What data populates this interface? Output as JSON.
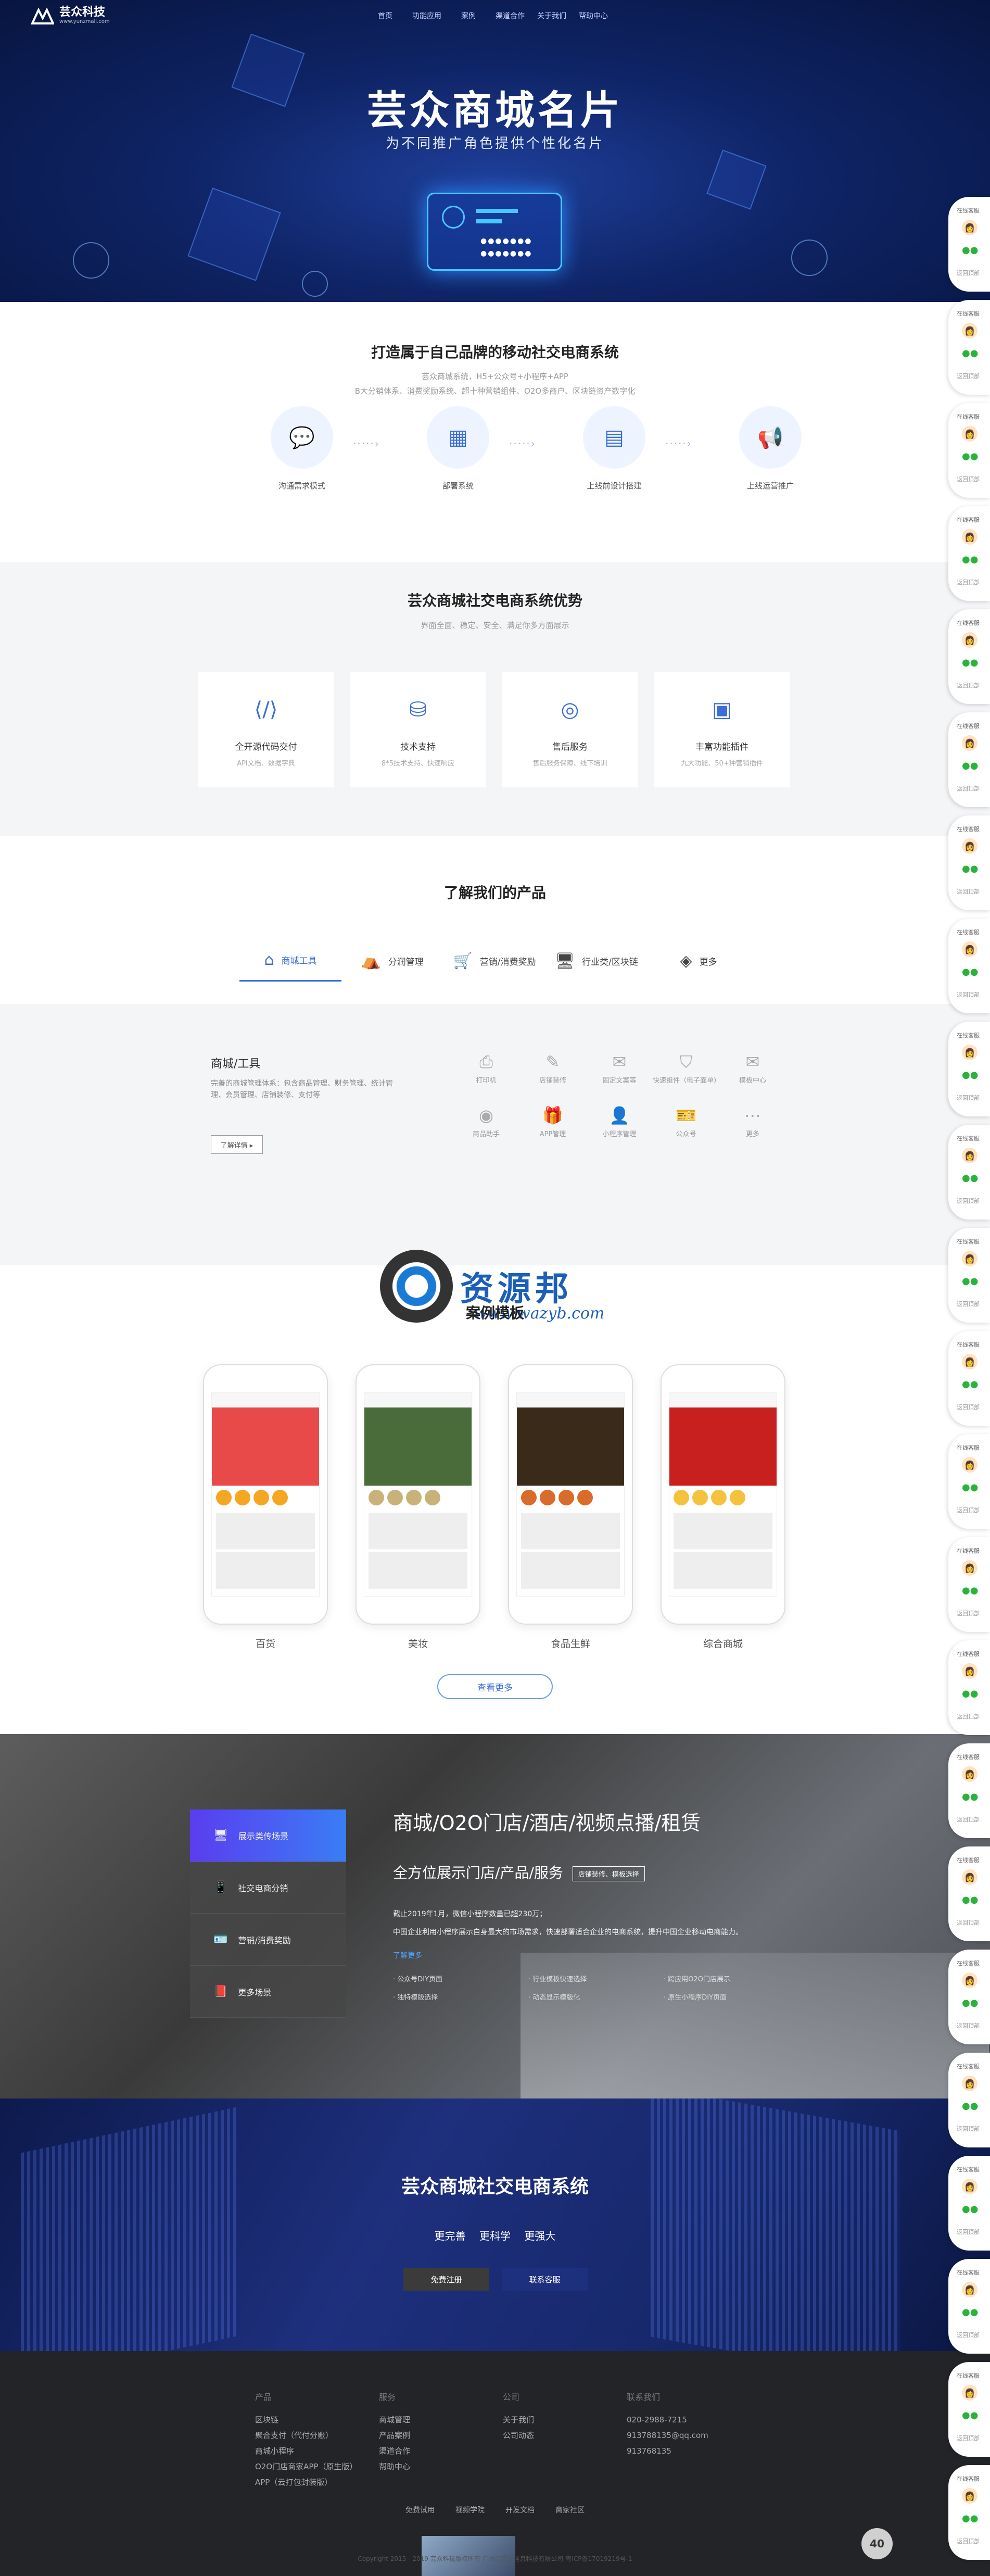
{
  "brand": {
    "name": "芸众科技",
    "url": "www.yunzmall.com"
  },
  "nav": [
    "首页",
    "功能应用",
    "案例",
    "渠道合作",
    "关于我们",
    "帮助中心"
  ],
  "hero": {
    "title": "芸众商城名片",
    "subtitle": "为不同推广角色提供个性化名片"
  },
  "build": {
    "title": "打造属于自己品牌的移动社交电商系统",
    "line1": "芸众商城系统，H5+公众号+小程序+APP",
    "line2": "B大分销体系、消费奖励系统、超十种营销组件、O2O多商户、区块链资产数字化",
    "steps": [
      {
        "icon": "chat-icon",
        "glyph": "💬",
        "label": "沟通需求模式"
      },
      {
        "icon": "grid-icon",
        "glyph": "▦",
        "label": "部署系统"
      },
      {
        "icon": "doc-icon",
        "glyph": "▤",
        "label": "上线前设计搭建"
      },
      {
        "icon": "megaphone-icon",
        "glyph": "📢",
        "label": "上线运营推广"
      }
    ]
  },
  "adv": {
    "title": "芸众商城社交电商系统优势",
    "subtitle": "界面全面、稳定、安全、满足你多方面展示",
    "cards": [
      {
        "icon": "code-icon",
        "glyph": "⟨/⟩",
        "title": "全开源代码交付",
        "desc": "API文档、数据字典"
      },
      {
        "icon": "support-icon",
        "glyph": "⛁",
        "title": "技术支持",
        "desc": "8*5技术支持、快速响应"
      },
      {
        "icon": "service-icon",
        "glyph": "◎",
        "title": "售后服务",
        "desc": "售后服务保障、线下培训"
      },
      {
        "icon": "plugin-icon",
        "glyph": "▣",
        "title": "丰富功能插件",
        "desc": "九大功能、50+种营销插件"
      }
    ]
  },
  "products": {
    "title": "了解我们的产品",
    "tabs": [
      {
        "icon": "shop-icon",
        "glyph": "⌂",
        "label": "商城工具",
        "active": true
      },
      {
        "icon": "store-icon",
        "glyph": "⛺",
        "label": "分润管理",
        "active": false
      },
      {
        "icon": "cart-icon",
        "glyph": "🛒",
        "label": "营销/消费奖励",
        "active": false
      },
      {
        "icon": "monitor-icon",
        "glyph": "🖥",
        "label": "行业类/区块链",
        "active": false
      },
      {
        "icon": "layers-icon",
        "glyph": "◈",
        "label": "更多",
        "active": false
      }
    ],
    "detail": {
      "title": "商城/工具",
      "desc": "完善的商城管理体系：包含商品管理、财务管理、统计管理、会员管理、店铺装修、支付等",
      "button": "了解详情 ▸",
      "tools": [
        {
          "icon": "printer-icon",
          "glyph": "⎙",
          "label": "打印机"
        },
        {
          "icon": "brush-icon",
          "glyph": "✎",
          "label": "店铺装修"
        },
        {
          "icon": "ticket-icon",
          "glyph": "✉",
          "label": "固定文案等"
        },
        {
          "icon": "shield-icon",
          "glyph": "⛉",
          "label": "快速组件（电子面单）"
        },
        {
          "icon": "mail-icon",
          "glyph": "✉",
          "label": "模板中心"
        },
        {
          "icon": "camera-icon",
          "glyph": "◉",
          "label": "商品助手"
        },
        {
          "icon": "gift-icon",
          "glyph": "🎁",
          "label": "APP管理"
        },
        {
          "icon": "user-icon",
          "glyph": "👤",
          "label": "小程序管理"
        },
        {
          "icon": "coupon-icon",
          "glyph": "🎫",
          "label": "公众号"
        },
        {
          "icon": "more-icon",
          "glyph": "⋯",
          "label": "更多"
        }
      ]
    }
  },
  "watermark": {
    "text": "资源邦",
    "url": "www.wazyb.com"
  },
  "templates": {
    "title": "案例模板",
    "items": [
      {
        "label": "百货",
        "hero": "#e84a4a",
        "accent": "#f5a623"
      },
      {
        "label": "美妆",
        "hero": "#4a6b3a",
        "accent": "#c9b27a"
      },
      {
        "label": "食品生鲜",
        "hero": "#3a2a1a",
        "accent": "#d96b2b"
      },
      {
        "label": "综合商城",
        "hero": "#c8201e",
        "accent": "#f4c23c"
      }
    ],
    "more": "查看更多"
  },
  "feature": {
    "menu": [
      {
        "icon": "monitor-icon",
        "glyph": "🖥",
        "label": "展示类传场景",
        "active": true
      },
      {
        "icon": "phone-icon",
        "glyph": "📱",
        "label": "社交电商分销",
        "active": false
      },
      {
        "icon": "vip-icon",
        "glyph": "🪪",
        "label": "营销/消费奖励",
        "active": false
      },
      {
        "icon": "book-icon",
        "glyph": "📕",
        "label": "更多场景",
        "active": false
      }
    ],
    "title": "商城/O2O门店/酒店/视频点播/租赁",
    "subtitle": "全方位展示门店/产品/服务",
    "tag": "店铺装修、模板选择",
    "p1": "截止2019年1月，微信小程序数量已超230万；",
    "p2": "中国企业利用小程序展示自身最大的市场需求，快速部署适合企业的电商系统，提升中国企业移动电商能力。",
    "link": "了解更多",
    "list": [
      "· 公众号DIY页面",
      "· 行业模板快速选择",
      "· 跨应用O2O门店展示",
      "· 独特模版选择",
      "· 动态显示模版化",
      "· 原生小程序DIY页面"
    ]
  },
  "cta": {
    "title": "芸众商城社交电商系统",
    "sub": "更完善 更科学 更强大",
    "btn1": "免费注册",
    "btn2": "联系客服"
  },
  "footer": {
    "cols": [
      {
        "h": "产品",
        "items": [
          "区块链",
          "聚合支付（代付分账）",
          "商城小程序",
          "O2O门店商家APP（原生版）",
          "APP（云打包封装版）"
        ]
      },
      {
        "h": "服务",
        "items": [
          "商城管理",
          "产品案例",
          "渠道合作",
          "帮助中心"
        ]
      },
      {
        "h": "公司",
        "items": [
          "关于我们",
          "公司动态"
        ]
      },
      {
        "h": "联系我们",
        "items": [
          "020-2988-7215",
          "913788135@qq.com",
          "913768135"
        ]
      }
    ],
    "links": [
      "免费试用",
      "视频学院",
      "开发文档",
      "商家社区"
    ],
    "copyright": "Copyright 2015 - 2019 芸众科技版权所有  广州市芸众信息科技有限公司  粤ICP备17019219号-1",
    "badge": "40"
  },
  "sidebar": {
    "top": "在线客服",
    "bottom": "返回顶部"
  },
  "colors": {
    "accent": "#3c6ed8",
    "hero_bg": "#0f2466",
    "footer_bg": "#232427"
  }
}
